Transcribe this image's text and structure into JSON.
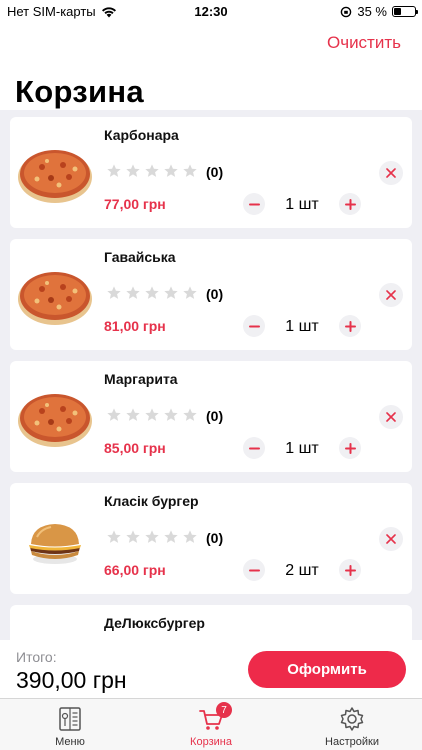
{
  "status": {
    "carrier": "Нет SIM-карты",
    "time": "12:30",
    "battery": "35 %",
    "battery_level": 0.35
  },
  "header": {
    "clear_label": "Очистить",
    "title": "Корзина"
  },
  "cart_items": [
    {
      "name": "Карбонара",
      "rating_count": "(0)",
      "price": "77,00 грн",
      "quantity": "1 шт",
      "image": "pizza-image"
    },
    {
      "name": "Гавайська",
      "rating_count": "(0)",
      "price": "81,00 грн",
      "quantity": "1 шт",
      "image": "pizza-image"
    },
    {
      "name": "Маргарита",
      "rating_count": "(0)",
      "price": "85,00 грн",
      "quantity": "1 шт",
      "image": "pizza-image"
    },
    {
      "name": "Класік бургер",
      "rating_count": "(0)",
      "price": "66,00 грн",
      "quantity": "2 шт",
      "image": "burger-image"
    },
    {
      "name": "ДеЛюксбургер"
    }
  ],
  "footer": {
    "total_label": "Итого:",
    "total_value": "390,00 грн",
    "checkout_label": "Оформить"
  },
  "tabs": [
    {
      "label": "Меню",
      "icon": "menu-book-icon"
    },
    {
      "label": "Корзина",
      "icon": "cart-icon",
      "badge": "7",
      "active": true
    },
    {
      "label": "Настройки",
      "icon": "gear-icon"
    }
  ],
  "colors": {
    "accent": "#e6324b",
    "button": "#ee2a4a",
    "background": "#efeff4"
  }
}
